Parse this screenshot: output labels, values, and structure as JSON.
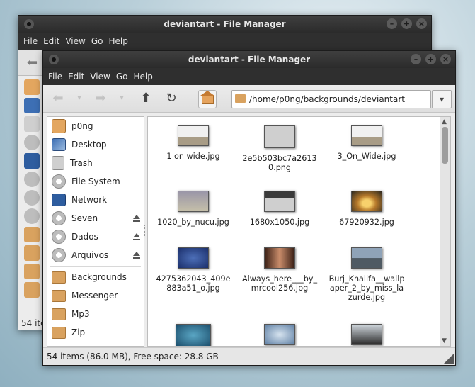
{
  "back_window": {
    "title": "deviantart - File Manager",
    "menu": [
      "File",
      "Edit",
      "View",
      "Go",
      "Help"
    ],
    "status_partial": "54 ite"
  },
  "window": {
    "title": "deviantart - File Manager",
    "menu": [
      "File",
      "Edit",
      "View",
      "Go",
      "Help"
    ],
    "path": "/home/p0ng/backgrounds/deviantart",
    "status": "54 items (86.0 MB), Free space: 28.8 GB"
  },
  "sidebar": [
    {
      "label": "p0ng",
      "icon": "home-folder-icon"
    },
    {
      "label": "Desktop",
      "icon": "desktop-icon"
    },
    {
      "label": "Trash",
      "icon": "trash-icon"
    },
    {
      "label": "File System",
      "icon": "drive-icon"
    },
    {
      "label": "Network",
      "icon": "network-icon"
    },
    {
      "label": "Seven",
      "icon": "drive-icon",
      "eject": true
    },
    {
      "label": "Dados",
      "icon": "drive-icon",
      "eject": true
    },
    {
      "label": "Arquivos",
      "icon": "drive-icon",
      "eject": true
    },
    {
      "label": "Backgrounds",
      "icon": "folder-icon"
    },
    {
      "label": "Messenger",
      "icon": "folder-icon"
    },
    {
      "label": "Mp3",
      "icon": "folder-icon"
    },
    {
      "label": "Zip",
      "icon": "folder-icon"
    }
  ],
  "files": [
    {
      "name": "1 on wide.jpg"
    },
    {
      "name": "2e5b503bc7a26130.png"
    },
    {
      "name": "3_On_Wide.jpg"
    },
    {
      "name": "1020_by_nucu.jpg"
    },
    {
      "name": "1680x1050.jpg"
    },
    {
      "name": "67920932.jpg"
    },
    {
      "name": "4275362043_409e883a51_o.jpg"
    },
    {
      "name": "Always_here___by_mrcool256.jpg"
    },
    {
      "name": "Burj_Khalifa__wallpaper_2_by_miss_lazurde.jpg"
    }
  ],
  "colors": {
    "titlebar": "#2f2f2f",
    "folder": "#d9a25f"
  }
}
